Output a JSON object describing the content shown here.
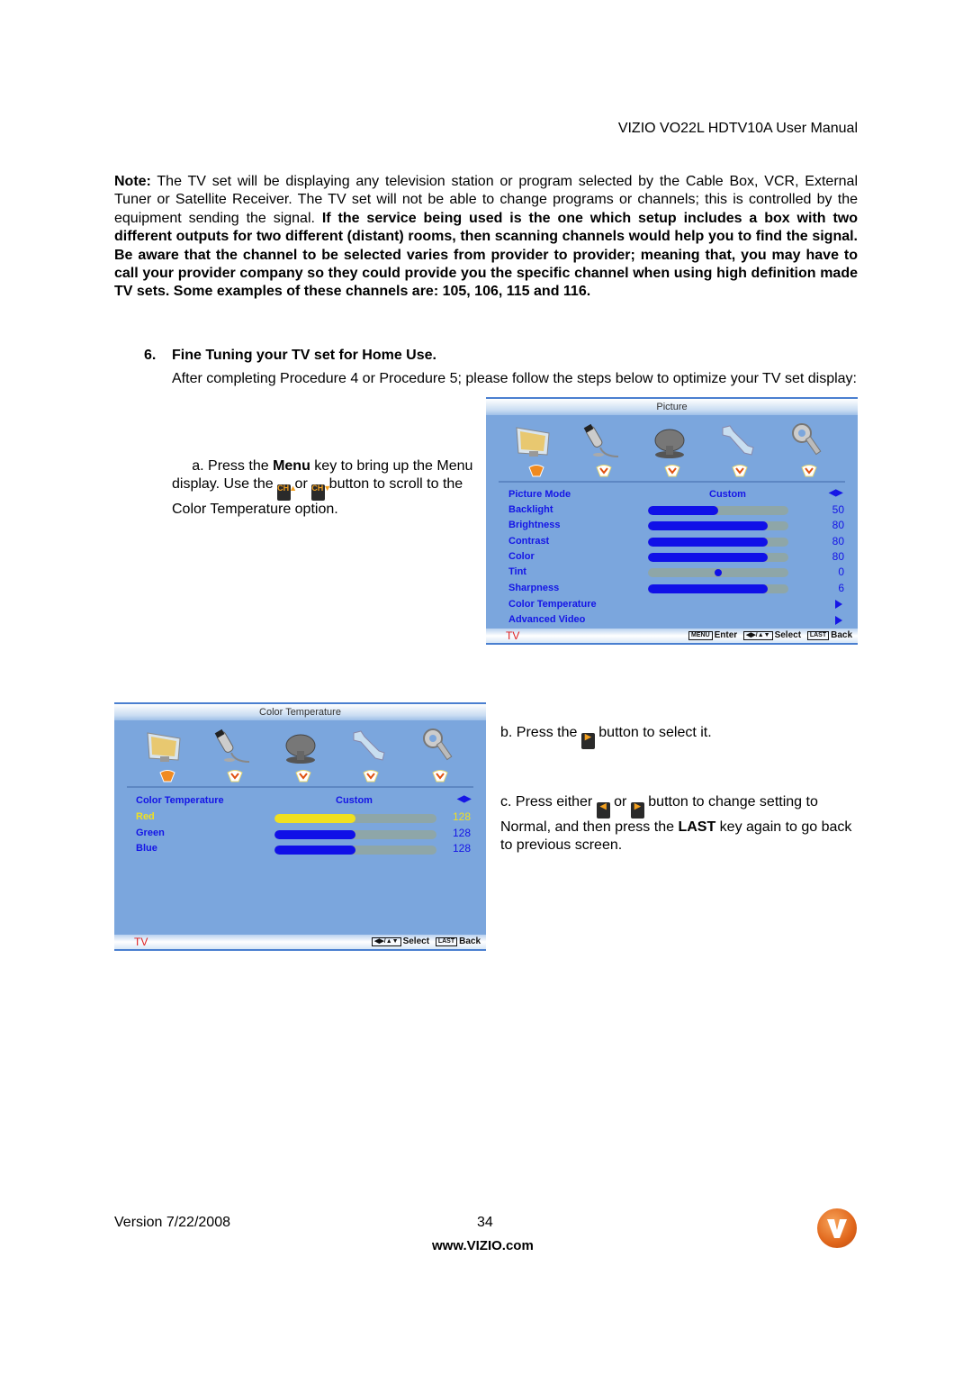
{
  "header": {
    "title": "VIZIO VO22L HDTV10A User Manual"
  },
  "note": {
    "label": "Note:",
    "text_regular": " The TV set will be displaying any television station or program selected by the Cable Box, VCR, External Tuner or Satellite Receiver. The TV set will not be able to change programs or channels; this is controlled by the equipment sending the signal. ",
    "text_bold": "If the service being used is the one which setup includes a box with two different outputs for two different (distant) rooms, then scanning channels would help you to find the signal. Be aware that the channel to be selected varies from provider to provider; meaning that, you may have to call your provider company so they could provide you the specific channel when using high definition made TV sets. Some examples of these channels are: 105, 106, 115 and 116."
  },
  "section": {
    "number": "6.",
    "title": "Fine Tuning your TV set for Home Use.",
    "intro": "After completing Procedure 4 or Procedure 5; please follow the steps below to optimize your TV set display:"
  },
  "steps": {
    "a": {
      "p1": "a. Press the ",
      "bold": "Menu",
      "p2": " key to bring up the Menu display. Use the ",
      "or": " or ",
      "p3": " button to scroll to the Color Temperature option.",
      "btn1": "CH▲",
      "btn2": "CH▼"
    },
    "b": {
      "p1": "b. Press the ",
      "p2": " button to select it.",
      "btn": "▶"
    },
    "c": {
      "p1": "c. Press either ",
      "or": " or ",
      "p2": " button to change setting to Normal, and then press the ",
      "bold": "LAST",
      "p3": " key again to go back to previous screen.",
      "btn1": "◀",
      "btn2": "▶"
    }
  },
  "picture_menu": {
    "title": "Picture",
    "icons": [
      "picture-monitor-icon",
      "audio-microphone-icon",
      "tv-satellite-dish-icon",
      "setup-wrench-icon",
      "parental-key-icon"
    ],
    "mode_label": "Picture Mode",
    "mode_value": "Custom",
    "rows": [
      {
        "label": "Backlight",
        "value": "50",
        "fill": 0.5
      },
      {
        "label": "Brightness",
        "value": "80",
        "fill": 0.85
      },
      {
        "label": "Contrast",
        "value": "80",
        "fill": 0.85
      },
      {
        "label": "Color",
        "value": "80",
        "fill": 0.85
      },
      {
        "label": "Tint",
        "value": "0",
        "fill": 0.5
      },
      {
        "label": "Sharpness",
        "value": "6",
        "fill": 0.85
      }
    ],
    "submenus": [
      "Color Temperature",
      "Advanced Video"
    ],
    "footer": {
      "source": "TV",
      "menu_key": "MENU",
      "enter": "Enter",
      "nav_key": "◀▶/▲▼",
      "select": "Select",
      "last_key": "LAST",
      "back": "Back"
    }
  },
  "color_temp_menu": {
    "title": "Color Temperature",
    "mode_label": "Color Temperature",
    "mode_value": "Custom",
    "rows": [
      {
        "label": "Red",
        "value": "128",
        "fill": 0.5,
        "color": "#f0e020"
      },
      {
        "label": "Green",
        "value": "128",
        "fill": 0.5,
        "color": "#1010e8"
      },
      {
        "label": "Blue",
        "value": "128",
        "fill": 0.5,
        "color": "#1010e8"
      }
    ],
    "footer": {
      "source": "TV",
      "nav_key": "◀▶/▲▼",
      "select": "Select",
      "last_key": "LAST",
      "back": "Back"
    }
  },
  "footer": {
    "version": "Version 7/22/2008",
    "page": "34",
    "url": "www.VIZIO.com",
    "logo": "V"
  }
}
